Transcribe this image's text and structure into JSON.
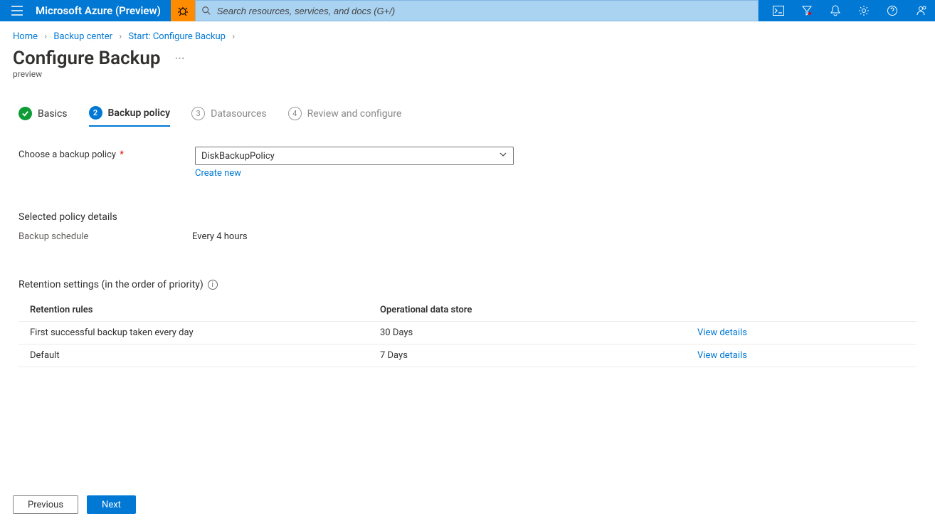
{
  "topbar": {
    "brand": "Microsoft Azure (Preview)",
    "search_placeholder": "Search resources, services, and docs (G+/)"
  },
  "breadcrumb": {
    "items": [
      "Home",
      "Backup center",
      "Start: Configure Backup"
    ]
  },
  "page": {
    "title": "Configure Backup",
    "subtitle": "preview"
  },
  "steps": [
    {
      "num": "✓",
      "label": "Basics",
      "state": "done"
    },
    {
      "num": "2",
      "label": "Backup policy",
      "state": "active"
    },
    {
      "num": "3",
      "label": "Datasources",
      "state": "pending"
    },
    {
      "num": "4",
      "label": "Review and configure",
      "state": "pending"
    }
  ],
  "form": {
    "policy_label": "Choose a backup policy",
    "policy_value": "DiskBackupPolicy",
    "create_new": "Create new"
  },
  "policy_details": {
    "section_title": "Selected policy details",
    "schedule_label": "Backup schedule",
    "schedule_value": "Every 4 hours"
  },
  "retention": {
    "title": "Retention settings (in the order of priority)",
    "columns": [
      "Retention rules",
      "Operational data store"
    ],
    "rows": [
      {
        "rule": "First successful backup taken every day",
        "store": "30 Days",
        "link": "View details"
      },
      {
        "rule": "Default",
        "store": "7 Days",
        "link": "View details"
      }
    ]
  },
  "footer": {
    "prev": "Previous",
    "next": "Next"
  }
}
